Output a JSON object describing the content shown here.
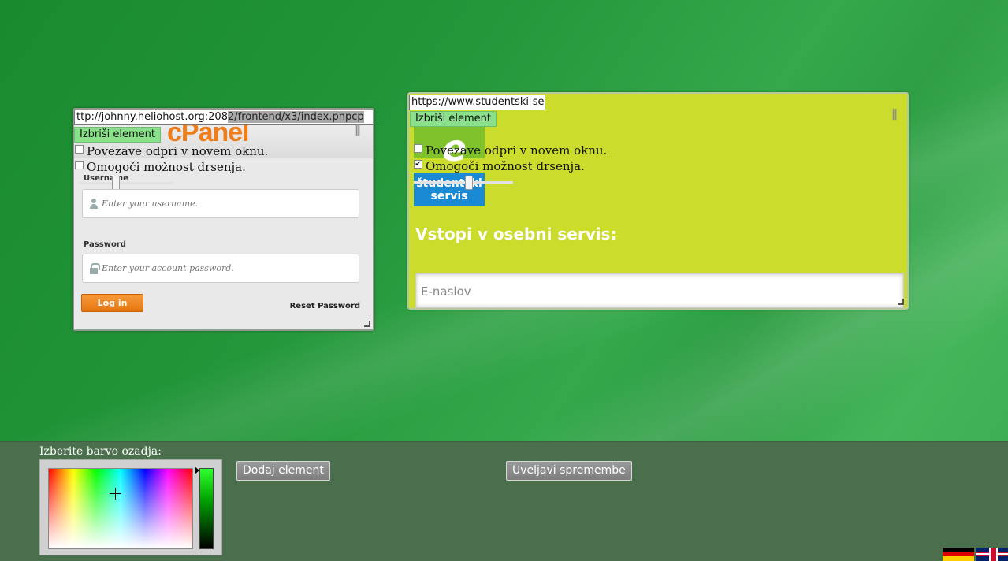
{
  "widgets": [
    {
      "url": "ttp://johnny.heliohost.org:2082/frontend/x3/index.phpcp",
      "url_plain": "ttp://johnny.heliohost.org:208",
      "url_selected": "2/frontend/x3/index.phpcp",
      "delete_label": "Izbriši element",
      "open_new_window_label": "Povezave odpri v novem oknu.",
      "open_new_window_checked": false,
      "enable_scroll_label": "Omogoči možnost drsenja.",
      "enable_scroll_checked": false,
      "content": {
        "logo": "cPanel",
        "username_label": "Username",
        "username_placeholder": "Enter your username.",
        "password_label": "Password",
        "password_placeholder": "Enter your account password.",
        "login_button": "Log in",
        "reset_link": "Reset Password"
      }
    },
    {
      "url": "https://www.studentski-servis",
      "delete_label": "Izbriši element",
      "open_new_window_label": "Povezave odpri v novem oknu.",
      "open_new_window_checked": false,
      "enable_scroll_label": "Omogoči možnost drsenja.",
      "enable_scroll_checked": true,
      "check_mark": "✔",
      "content": {
        "logo_letter": "e",
        "logo_text": "študentski servis",
        "title": "Vstopi v osebni servis:",
        "email_placeholder": "E-naslov"
      }
    }
  ],
  "bottom_panel": {
    "background_color_label": "Izberite barvo ozadja:",
    "add_element_button": "Dodaj element",
    "apply_changes_button": "Uveljavi spremembe",
    "selected_hue": "#00a000"
  },
  "languages": [
    "de",
    "en"
  ],
  "icons": {
    "user": "user-icon",
    "lock": "lock-icon",
    "grip": "grip-icon",
    "resize": "resize-handle-icon"
  },
  "grip_glyph": "|||"
}
